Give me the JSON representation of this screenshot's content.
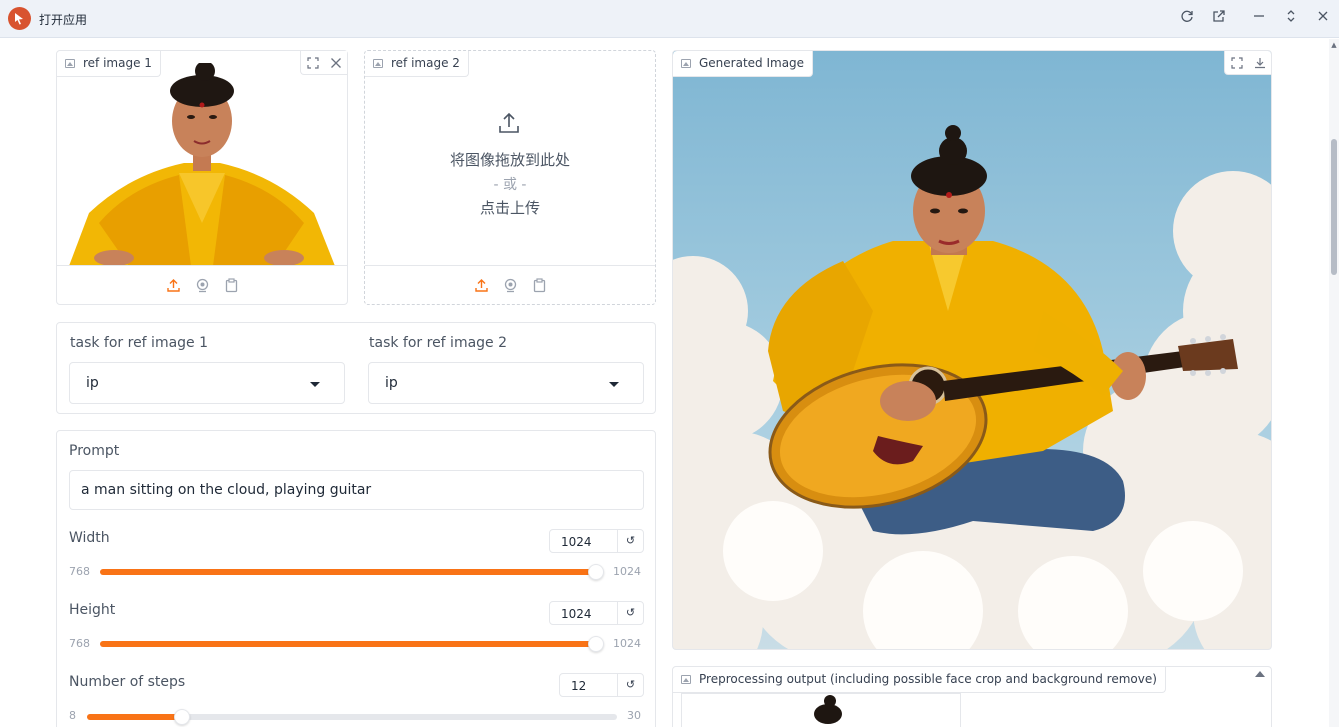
{
  "window": {
    "title": "打开应用",
    "icons": [
      "app-logo-icon",
      "refresh-icon",
      "open-external-icon",
      "minimize-icon",
      "expand-icon",
      "close-icon"
    ]
  },
  "ref_image_1": {
    "label": "ref image 1"
  },
  "ref_image_2": {
    "label": "ref image 2",
    "drop_text": "将图像拖放到此处",
    "or_text": "- 或 -",
    "click_text": "点击上传"
  },
  "tasks": {
    "task1_label": "task for ref image 1",
    "task1_value": "ip",
    "task2_label": "task for ref image 2",
    "task2_value": "ip"
  },
  "prompt": {
    "label": "Prompt",
    "value": "a man sitting on the cloud, playing guitar"
  },
  "width": {
    "label": "Width",
    "value": "1024",
    "min": "768",
    "max": "1024",
    "fraction": 1.0
  },
  "height": {
    "label": "Height",
    "value": "1024",
    "min": "768",
    "max": "1024",
    "fraction": 1.0
  },
  "steps": {
    "label": "Number of steps",
    "value": "12",
    "min": "8",
    "max": "30",
    "fraction": 0.18
  },
  "generated": {
    "label": "Generated Image"
  },
  "preprocess": {
    "label": "Preprocessing output (including possible face crop and background remove)"
  },
  "colors": {
    "accent": "#f97316",
    "sky": "#8fc1db",
    "robe": "#f5b800"
  }
}
